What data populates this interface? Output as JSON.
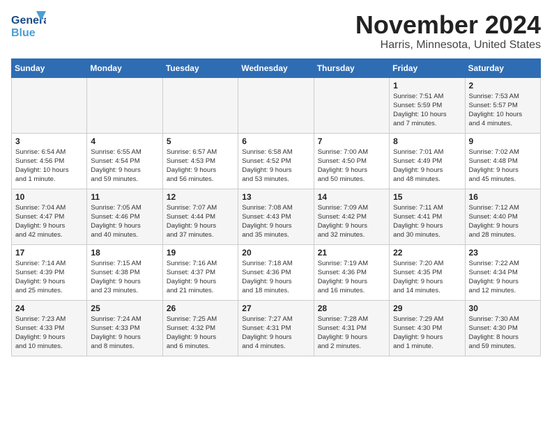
{
  "header": {
    "logo_general": "General",
    "logo_blue": "Blue",
    "month_title": "November 2024",
    "location": "Harris, Minnesota, United States"
  },
  "weekdays": [
    "Sunday",
    "Monday",
    "Tuesday",
    "Wednesday",
    "Thursday",
    "Friday",
    "Saturday"
  ],
  "weeks": [
    [
      {
        "day": "",
        "info": ""
      },
      {
        "day": "",
        "info": ""
      },
      {
        "day": "",
        "info": ""
      },
      {
        "day": "",
        "info": ""
      },
      {
        "day": "",
        "info": ""
      },
      {
        "day": "1",
        "info": "Sunrise: 7:51 AM\nSunset: 5:59 PM\nDaylight: 10 hours\nand 7 minutes."
      },
      {
        "day": "2",
        "info": "Sunrise: 7:53 AM\nSunset: 5:57 PM\nDaylight: 10 hours\nand 4 minutes."
      }
    ],
    [
      {
        "day": "3",
        "info": "Sunrise: 6:54 AM\nSunset: 4:56 PM\nDaylight: 10 hours\nand 1 minute."
      },
      {
        "day": "4",
        "info": "Sunrise: 6:55 AM\nSunset: 4:54 PM\nDaylight: 9 hours\nand 59 minutes."
      },
      {
        "day": "5",
        "info": "Sunrise: 6:57 AM\nSunset: 4:53 PM\nDaylight: 9 hours\nand 56 minutes."
      },
      {
        "day": "6",
        "info": "Sunrise: 6:58 AM\nSunset: 4:52 PM\nDaylight: 9 hours\nand 53 minutes."
      },
      {
        "day": "7",
        "info": "Sunrise: 7:00 AM\nSunset: 4:50 PM\nDaylight: 9 hours\nand 50 minutes."
      },
      {
        "day": "8",
        "info": "Sunrise: 7:01 AM\nSunset: 4:49 PM\nDaylight: 9 hours\nand 48 minutes."
      },
      {
        "day": "9",
        "info": "Sunrise: 7:02 AM\nSunset: 4:48 PM\nDaylight: 9 hours\nand 45 minutes."
      }
    ],
    [
      {
        "day": "10",
        "info": "Sunrise: 7:04 AM\nSunset: 4:47 PM\nDaylight: 9 hours\nand 42 minutes."
      },
      {
        "day": "11",
        "info": "Sunrise: 7:05 AM\nSunset: 4:46 PM\nDaylight: 9 hours\nand 40 minutes."
      },
      {
        "day": "12",
        "info": "Sunrise: 7:07 AM\nSunset: 4:44 PM\nDaylight: 9 hours\nand 37 minutes."
      },
      {
        "day": "13",
        "info": "Sunrise: 7:08 AM\nSunset: 4:43 PM\nDaylight: 9 hours\nand 35 minutes."
      },
      {
        "day": "14",
        "info": "Sunrise: 7:09 AM\nSunset: 4:42 PM\nDaylight: 9 hours\nand 32 minutes."
      },
      {
        "day": "15",
        "info": "Sunrise: 7:11 AM\nSunset: 4:41 PM\nDaylight: 9 hours\nand 30 minutes."
      },
      {
        "day": "16",
        "info": "Sunrise: 7:12 AM\nSunset: 4:40 PM\nDaylight: 9 hours\nand 28 minutes."
      }
    ],
    [
      {
        "day": "17",
        "info": "Sunrise: 7:14 AM\nSunset: 4:39 PM\nDaylight: 9 hours\nand 25 minutes."
      },
      {
        "day": "18",
        "info": "Sunrise: 7:15 AM\nSunset: 4:38 PM\nDaylight: 9 hours\nand 23 minutes."
      },
      {
        "day": "19",
        "info": "Sunrise: 7:16 AM\nSunset: 4:37 PM\nDaylight: 9 hours\nand 21 minutes."
      },
      {
        "day": "20",
        "info": "Sunrise: 7:18 AM\nSunset: 4:36 PM\nDaylight: 9 hours\nand 18 minutes."
      },
      {
        "day": "21",
        "info": "Sunrise: 7:19 AM\nSunset: 4:36 PM\nDaylight: 9 hours\nand 16 minutes."
      },
      {
        "day": "22",
        "info": "Sunrise: 7:20 AM\nSunset: 4:35 PM\nDaylight: 9 hours\nand 14 minutes."
      },
      {
        "day": "23",
        "info": "Sunrise: 7:22 AM\nSunset: 4:34 PM\nDaylight: 9 hours\nand 12 minutes."
      }
    ],
    [
      {
        "day": "24",
        "info": "Sunrise: 7:23 AM\nSunset: 4:33 PM\nDaylight: 9 hours\nand 10 minutes."
      },
      {
        "day": "25",
        "info": "Sunrise: 7:24 AM\nSunset: 4:33 PM\nDaylight: 9 hours\nand 8 minutes."
      },
      {
        "day": "26",
        "info": "Sunrise: 7:25 AM\nSunset: 4:32 PM\nDaylight: 9 hours\nand 6 minutes."
      },
      {
        "day": "27",
        "info": "Sunrise: 7:27 AM\nSunset: 4:31 PM\nDaylight: 9 hours\nand 4 minutes."
      },
      {
        "day": "28",
        "info": "Sunrise: 7:28 AM\nSunset: 4:31 PM\nDaylight: 9 hours\nand 2 minutes."
      },
      {
        "day": "29",
        "info": "Sunrise: 7:29 AM\nSunset: 4:30 PM\nDaylight: 9 hours\nand 1 minute."
      },
      {
        "day": "30",
        "info": "Sunrise: 7:30 AM\nSunset: 4:30 PM\nDaylight: 8 hours\nand 59 minutes."
      }
    ]
  ]
}
